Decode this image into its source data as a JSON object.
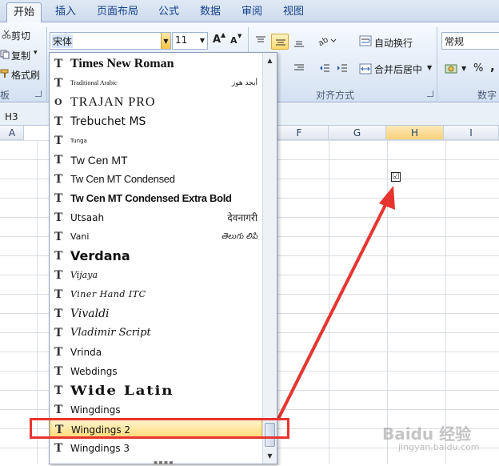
{
  "ribbon_tabs": [
    "开始",
    "插入",
    "页面布局",
    "公式",
    "数据",
    "审阅",
    "视图"
  ],
  "clipboard": {
    "cut": "剪切",
    "copy": "复制",
    "copy_arrow": "▾",
    "format_painter": "格式刷",
    "group_label_partial": "板"
  },
  "font": {
    "current_font": "宋体",
    "size": "11",
    "grow": "A",
    "shrink": "A"
  },
  "alignment": {
    "wrap_text": "自动换行",
    "merge_center": "合并后居中",
    "group_label": "对齐方式"
  },
  "number": {
    "format": "常规",
    "percent": "%",
    "comma": ",",
    "group_label": "数字"
  },
  "name_box": "H3",
  "columns": [
    "A",
    "F",
    "G",
    "H",
    "I"
  ],
  "cell_h3_symbol": "☑",
  "font_list": [
    {
      "name": "Times New Roman",
      "sample": ""
    },
    {
      "name": "Traditional Arabic",
      "sample": "أبجد هوز"
    },
    {
      "name": "Trajan Pro",
      "sample": ""
    },
    {
      "name": "Trebuchet MS",
      "sample": ""
    },
    {
      "name": "Tunga",
      "sample": ""
    },
    {
      "name": "Tw Cen MT",
      "sample": ""
    },
    {
      "name": "Tw Cen MT Condensed",
      "sample": ""
    },
    {
      "name": "Tw Cen MT Condensed Extra Bold",
      "sample": ""
    },
    {
      "name": "Utsaah",
      "sample": "देवनागरी"
    },
    {
      "name": "Vani",
      "sample": "తెలుగు లిపి"
    },
    {
      "name": "Verdana",
      "sample": ""
    },
    {
      "name": "Vijaya",
      "sample": ""
    },
    {
      "name": "Viner Hand ITC",
      "sample": ""
    },
    {
      "name": "Vivaldi",
      "sample": ""
    },
    {
      "name": "Vladimir Script",
      "sample": ""
    },
    {
      "name": "Vrinda",
      "sample": ""
    },
    {
      "name": "Webdings",
      "sample": ""
    },
    {
      "name": "Wide Latin",
      "sample": ""
    },
    {
      "name": "Wingdings",
      "sample": ""
    },
    {
      "name": "Wingdings 2",
      "sample": ""
    },
    {
      "name": "Wingdings 3",
      "sample": ""
    }
  ],
  "selected_font": "Wingdings 2",
  "watermark": {
    "brand": "Baidu 经验",
    "sub": "jingyan.baidu.com"
  },
  "colors": {
    "highlight": "#e8342f",
    "selection": "#ffd977"
  }
}
